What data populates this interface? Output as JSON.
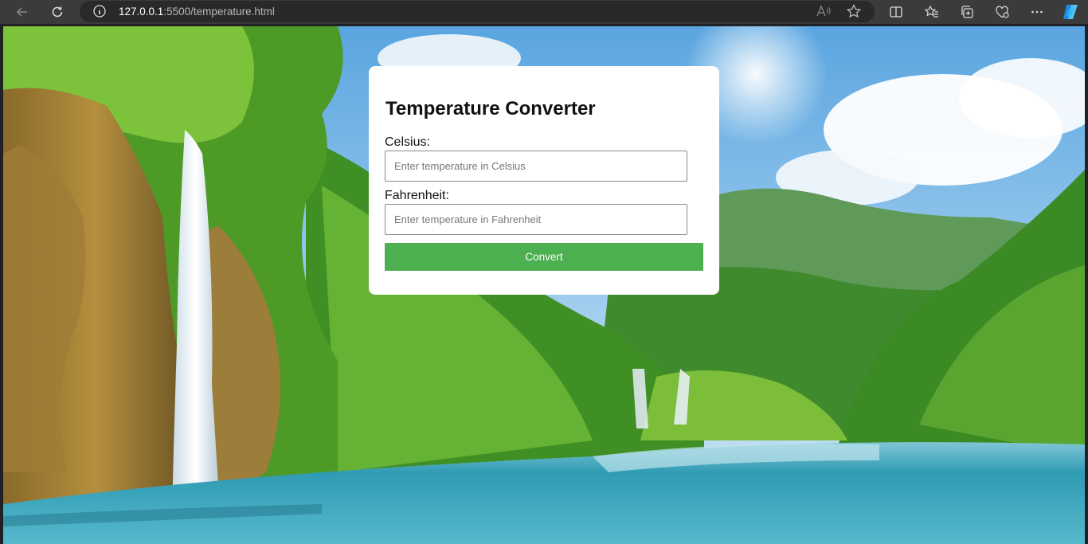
{
  "browser": {
    "url_host": "127.0.0.1",
    "url_rest": ":5500/temperature.html"
  },
  "icons": {
    "back": "back-arrow-icon",
    "refresh": "refresh-icon",
    "info": "info-icon",
    "read_aloud": "read-aloud-icon",
    "favorite": "star-icon",
    "split_screen": "split-screen-icon",
    "favorites": "favorites-icon",
    "collections": "collections-icon",
    "health": "browser-essentials-icon",
    "more": "more-icon",
    "copilot": "copilot-icon"
  },
  "converter": {
    "title": "Temperature Converter",
    "celsius_label": "Celsius:",
    "celsius_placeholder": "Enter temperature in Celsius",
    "celsius_value": "",
    "fahrenheit_label": "Fahrenheit:",
    "fahrenheit_placeholder": "Enter temperature in Fahrenheit",
    "fahrenheit_value": "",
    "convert_label": "Convert"
  },
  "colors": {
    "button": "#4caf50",
    "toolbar": "#3b3b3b"
  }
}
